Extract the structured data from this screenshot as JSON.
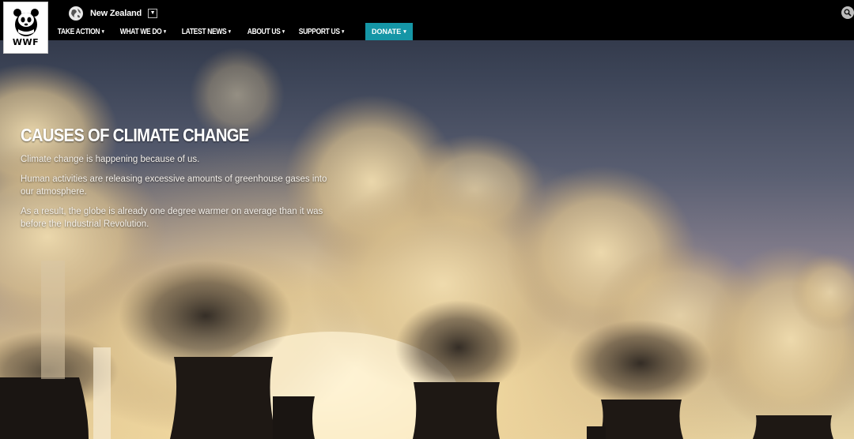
{
  "header": {
    "logo_text": "WWF",
    "region": "New Zealand",
    "region_caret": "▼",
    "nav_items": [
      {
        "label": "TAKE ACTION",
        "caret": "▾"
      },
      {
        "label": "WHAT WE DO",
        "caret": "▾"
      },
      {
        "label": "LATEST NEWS",
        "caret": "▾"
      },
      {
        "label": "ABOUT US",
        "caret": "▾"
      },
      {
        "label": "SUPPORT US",
        "caret": "▾"
      }
    ],
    "donate": {
      "label": "DONATE",
      "caret": "▾",
      "color": "#1596a6"
    }
  },
  "hero": {
    "title": "CAUSES OF CLIMATE CHANGE",
    "paragraphs": [
      "Climate change is happening because of us.",
      "Human activities are releasing excessive amounts of greenhouse gases into our atmosphere.",
      "As a result, the globe is already one degree warmer on average than it was before the Industrial Revolution."
    ]
  },
  "icons": {
    "logo": "panda-logo-icon",
    "region": "globe-icon",
    "search": "search-icon"
  },
  "colors": {
    "header_bg": "#000000",
    "accent": "#1596a6"
  }
}
